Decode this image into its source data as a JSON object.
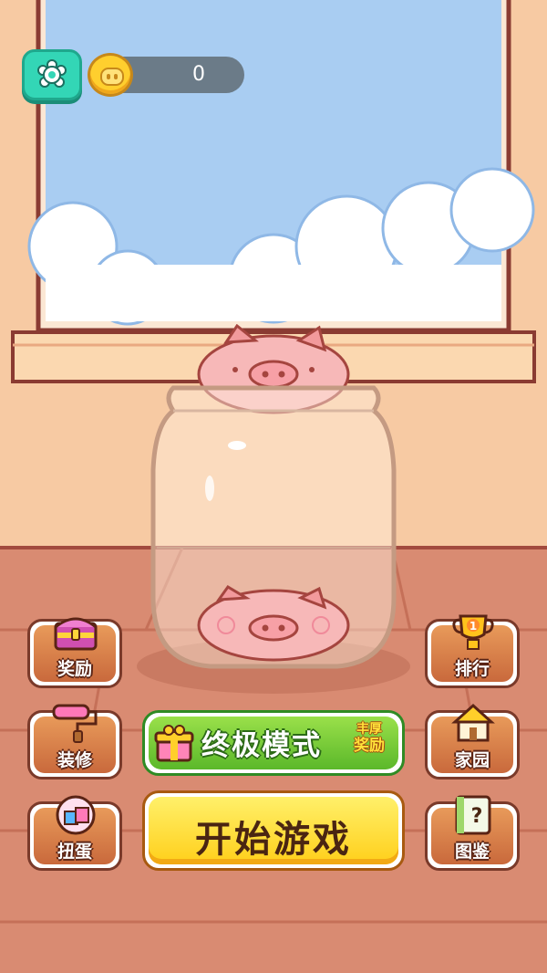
{
  "hud": {
    "settings_icon": "gear-icon",
    "coin_icon": "pig-coin-icon",
    "coins": "0"
  },
  "left_buttons": [
    {
      "id": "rewards",
      "label": "奖励",
      "icon": "treasure-chest-icon"
    },
    {
      "id": "decorate",
      "label": "装修",
      "icon": "paint-roller-icon"
    },
    {
      "id": "gacha",
      "label": "扭蛋",
      "icon": "gift-capsule-icon"
    }
  ],
  "right_buttons": [
    {
      "id": "ranking",
      "label": "排行",
      "icon": "trophy-icon",
      "trophy_rank": "1"
    },
    {
      "id": "home",
      "label": "家园",
      "icon": "house-icon"
    },
    {
      "id": "collection",
      "label": "图鉴",
      "icon": "book-question-icon",
      "glyph": "?"
    }
  ],
  "ultimate_mode": {
    "label": "终极模式",
    "badge_line1": "丰厚",
    "badge_line2": "奖励",
    "icon": "gift-box-icon"
  },
  "start_game": {
    "label": "开始游戏"
  },
  "colors": {
    "sky": "#a9cdf2",
    "wall": "#f7caa3",
    "floor": "#d98b72",
    "accent_green": "#5bb82a",
    "accent_yellow": "#ffcf1a",
    "settings_teal": "#33d6b6"
  }
}
